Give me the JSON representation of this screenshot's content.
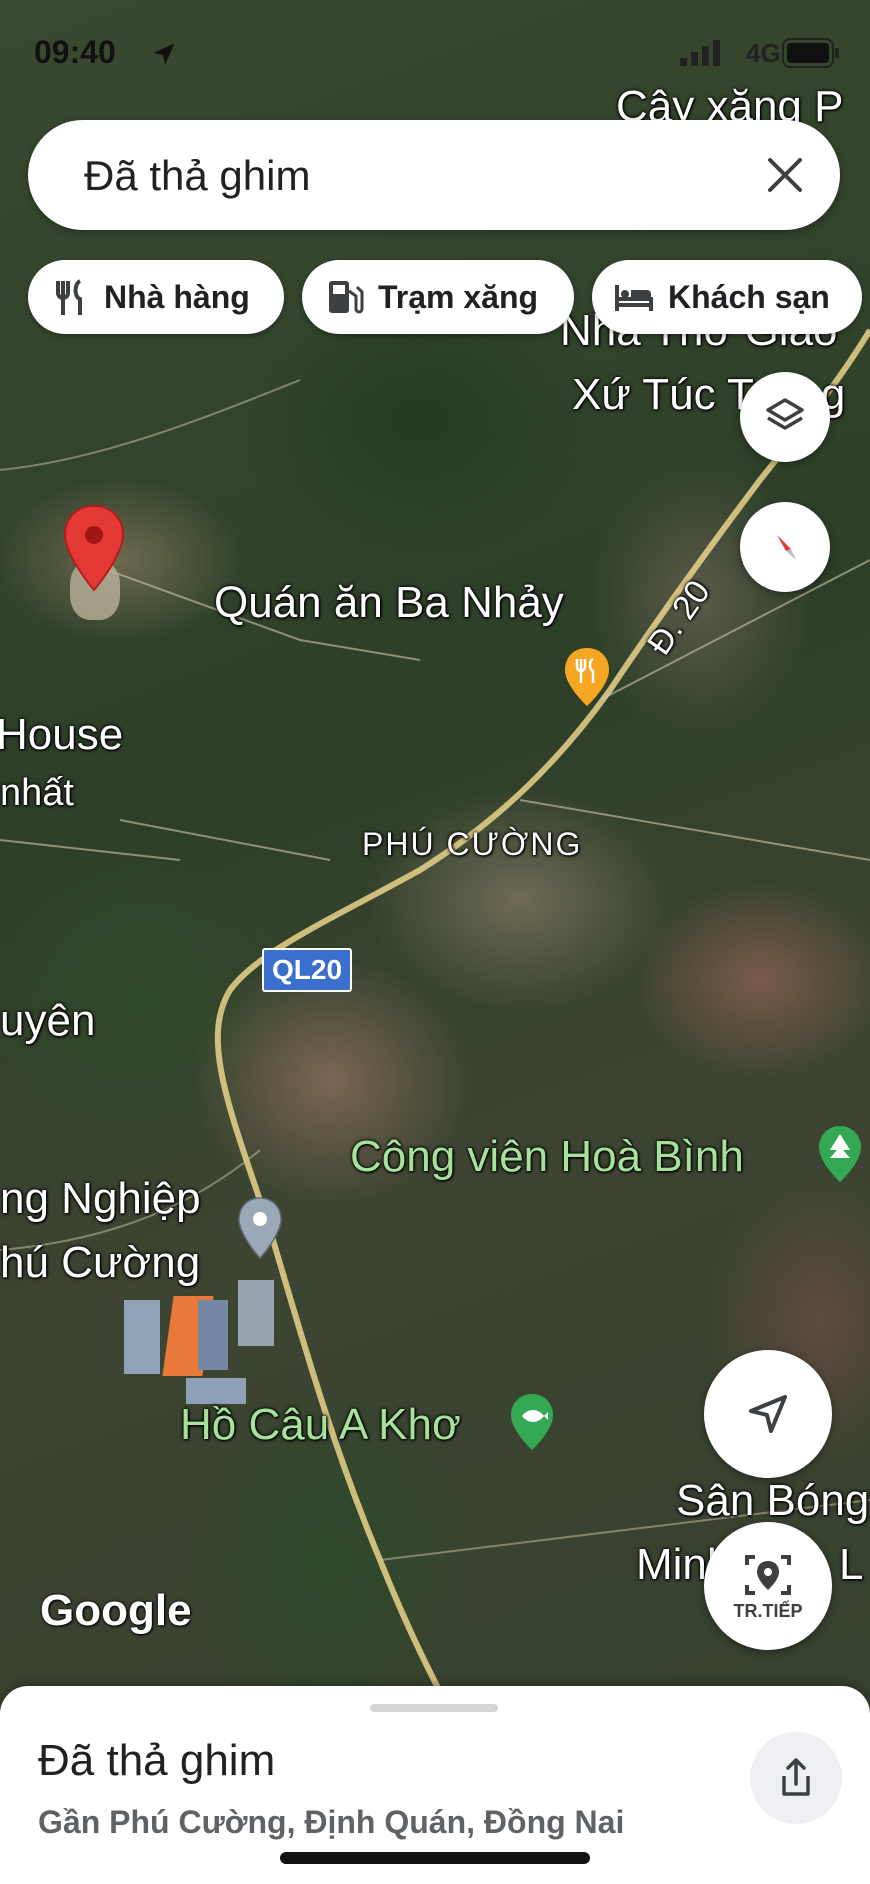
{
  "status_bar": {
    "time": "09:40",
    "network": "4G"
  },
  "search": {
    "value": "Đã thả ghim"
  },
  "chips": [
    {
      "label": "Nhà hàng",
      "icon": "restaurant-icon"
    },
    {
      "label": "Trạm xăng",
      "icon": "gas-station-icon"
    },
    {
      "label": "Khách sạn",
      "icon": "hotel-icon"
    }
  ],
  "map_labels": {
    "gas_station": "Cây xăng P",
    "church_1": "Nhà Thờ Giáo",
    "church_2": "Xứ Túc Trưng",
    "restaurant": "Quán ăn Ba Nhảy",
    "road_d20": "Đ. 20",
    "house_1": "House",
    "house_2": "nhất",
    "town": "PHÚ CƯỜNG",
    "highway": "QL20",
    "uyen": "uyên",
    "park": "Công viên Hoà Bình",
    "industrial_1": "ng Nghiệp",
    "industrial_2": "hú Cường",
    "fishing": "Hồ Câu A Khơ",
    "stadium_1": "Sân Bóng",
    "stadium_2": "Minh Đức L"
  },
  "buttons": {
    "layers": "layers-icon",
    "compass": "compass-icon",
    "my_location": "navigation-arrow-icon",
    "live_view": "TR.TIẾP"
  },
  "logo": "Google",
  "place": {
    "title": "Đã thả ghim",
    "address": "Gần Phú Cường, Định Quán, Đồng Nai"
  },
  "colors": {
    "pin": "#e53935",
    "restaurant_pin": "#f5a623",
    "park_pin": "#34a853",
    "highway_shield": "#3b6fce"
  }
}
